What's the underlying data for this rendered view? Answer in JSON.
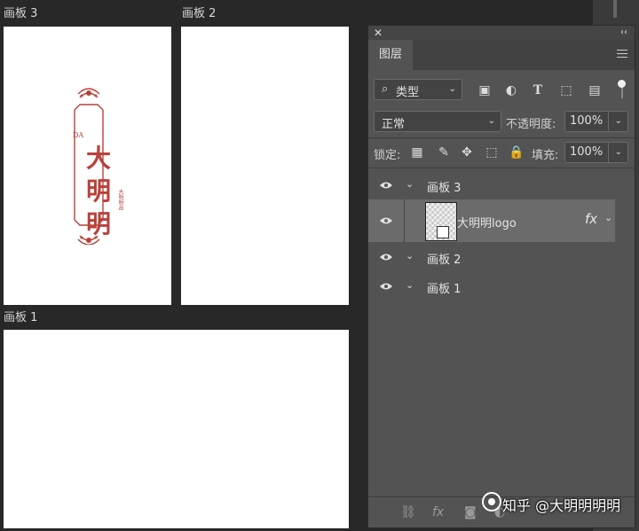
{
  "canvas": {
    "artboards": [
      {
        "label": "画板 3"
      },
      {
        "label": "画板 2"
      },
      {
        "label": "画板 1"
      }
    ],
    "logo": {
      "initials": "DA",
      "chars": [
        "大",
        "明",
        "明"
      ],
      "vertical_text": "大明明品",
      "color": "#b9413a"
    }
  },
  "panel": {
    "close": "✕",
    "collapse": "‹‹",
    "tab": "图层",
    "filter": {
      "label": "类型",
      "search_icon": "search-icon"
    },
    "filter_icons": [
      "image-filter-icon",
      "adjustment-filter-icon",
      "type-filter-icon",
      "shape-filter-icon",
      "smart-object-filter-icon"
    ],
    "blend_mode": "正常",
    "opacity_label": "不透明度:",
    "opacity_value": "100%",
    "lock_label": "锁定:",
    "fill_label": "填充:",
    "fill_value": "100%",
    "layers": [
      {
        "name": "画板 3",
        "type": "artboard"
      },
      {
        "name": "大明明logo",
        "type": "smart-object",
        "selected": true,
        "fx": "fx"
      },
      {
        "name": "画板 2",
        "type": "artboard"
      },
      {
        "name": "画板 1",
        "type": "artboard"
      }
    ],
    "bottom_icons": [
      "link-icon",
      "fx-icon",
      "mask-icon",
      "adjustment-icon"
    ],
    "bottom_fx": "fx"
  },
  "watermark": "知乎 @大明明明明"
}
